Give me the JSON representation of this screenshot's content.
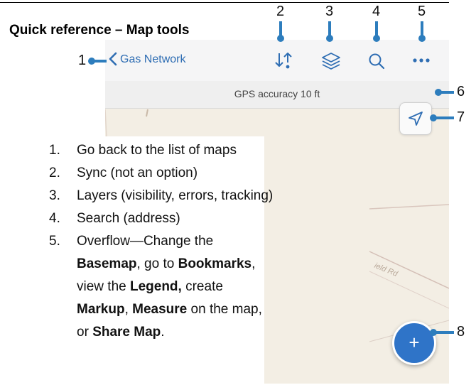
{
  "page": {
    "title": "Quick reference – Map tools"
  },
  "map": {
    "back_label": "Gas Network",
    "gps_text": "GPS accuracy 10 ft",
    "road_label": "ield Rd",
    "fab_label": "+",
    "icons": [
      "chevron-left-icon",
      "sync-icon",
      "layers-icon",
      "search-icon",
      "more-icon",
      "location-arrow-icon",
      "plus-icon"
    ]
  },
  "callouts": [
    "1",
    "2",
    "3",
    "4",
    "5",
    "6",
    "7",
    "8"
  ],
  "list": {
    "numbers": [
      "1.",
      "2.",
      "3.",
      "4.",
      "5."
    ],
    "item1": "Go back to the list of maps",
    "item2": "Sync (not an option)",
    "item3": "Layers (visibility, errors, tracking)",
    "item4": "Search (address)",
    "item5": {
      "t1": "Overflow—Change the ",
      "b1": "Basemap",
      "t2": ", go to ",
      "b2": "Bookmarks",
      "t3": ", view the ",
      "b3": "Legend,",
      "t4": " create ",
      "b4": "Markup",
      "t5": ", ",
      "b5": "Measure",
      "t6": " on the map, or ",
      "b6": "Share Map",
      "t7": "."
    }
  },
  "colors": {
    "accent": "#2d7dbd",
    "link": "#2e6db3",
    "fab": "#2f74c8",
    "map": "#f3eee4"
  }
}
